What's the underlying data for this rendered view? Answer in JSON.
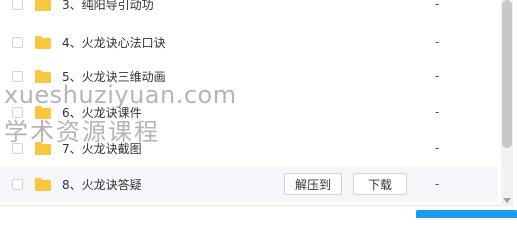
{
  "files": [
    {
      "name": "3、纯阳导引动功",
      "size": "-"
    },
    {
      "name": "4、火龙诀心法口诀",
      "size": "-"
    },
    {
      "name": "5、火龙诀三维动画",
      "size": "-"
    },
    {
      "name": "6、火龙诀课件",
      "size": "-"
    },
    {
      "name": "7、火龙诀截图",
      "size": "-"
    },
    {
      "name": "8、火龙诀答疑",
      "size": "-"
    }
  ],
  "actions": {
    "unzip_label": "解压到",
    "download_label": "下载"
  },
  "watermark": {
    "line1": "xueshuziyuan.com",
    "line2": "学术资源课程"
  },
  "colors": {
    "folder": "#f8c73d",
    "accent": "#1a9bf0",
    "hover_row": "#f4f6f9"
  },
  "icons": {
    "folder": "folder-icon",
    "checkbox": "checkbox"
  }
}
